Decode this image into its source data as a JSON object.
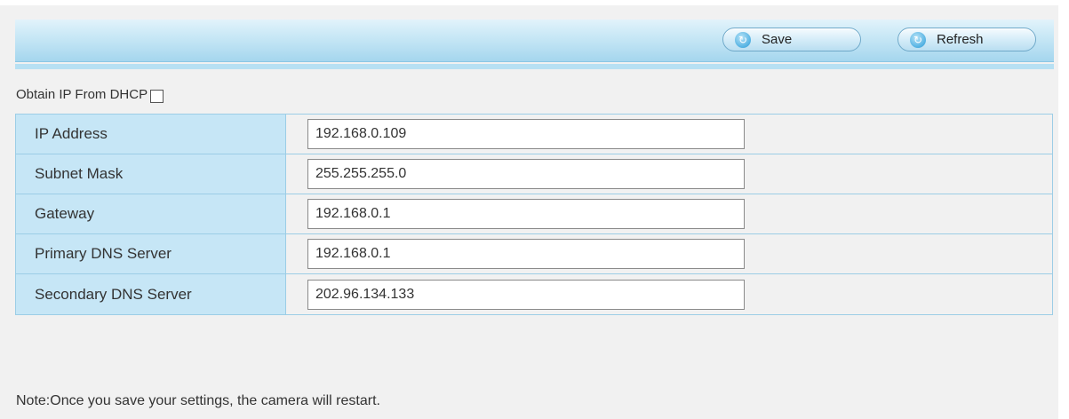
{
  "toolbar": {
    "save_label": "Save",
    "refresh_label": "Refresh"
  },
  "dhcp": {
    "label": "Obtain IP From DHCP",
    "checked": false
  },
  "fields": [
    {
      "label": "IP Address",
      "value": "192.168.0.109"
    },
    {
      "label": "Subnet Mask",
      "value": "255.255.255.0"
    },
    {
      "label": "Gateway",
      "value": "192.168.0.1"
    },
    {
      "label": "Primary DNS Server",
      "value": "192.168.0.1"
    },
    {
      "label": "Secondary DNS Server",
      "value": "202.96.134.133"
    }
  ],
  "note": "Note:Once you save your settings, the camera will restart.",
  "icons": {
    "save": "refresh-circle-icon",
    "refresh": "refresh-circle-icon"
  }
}
